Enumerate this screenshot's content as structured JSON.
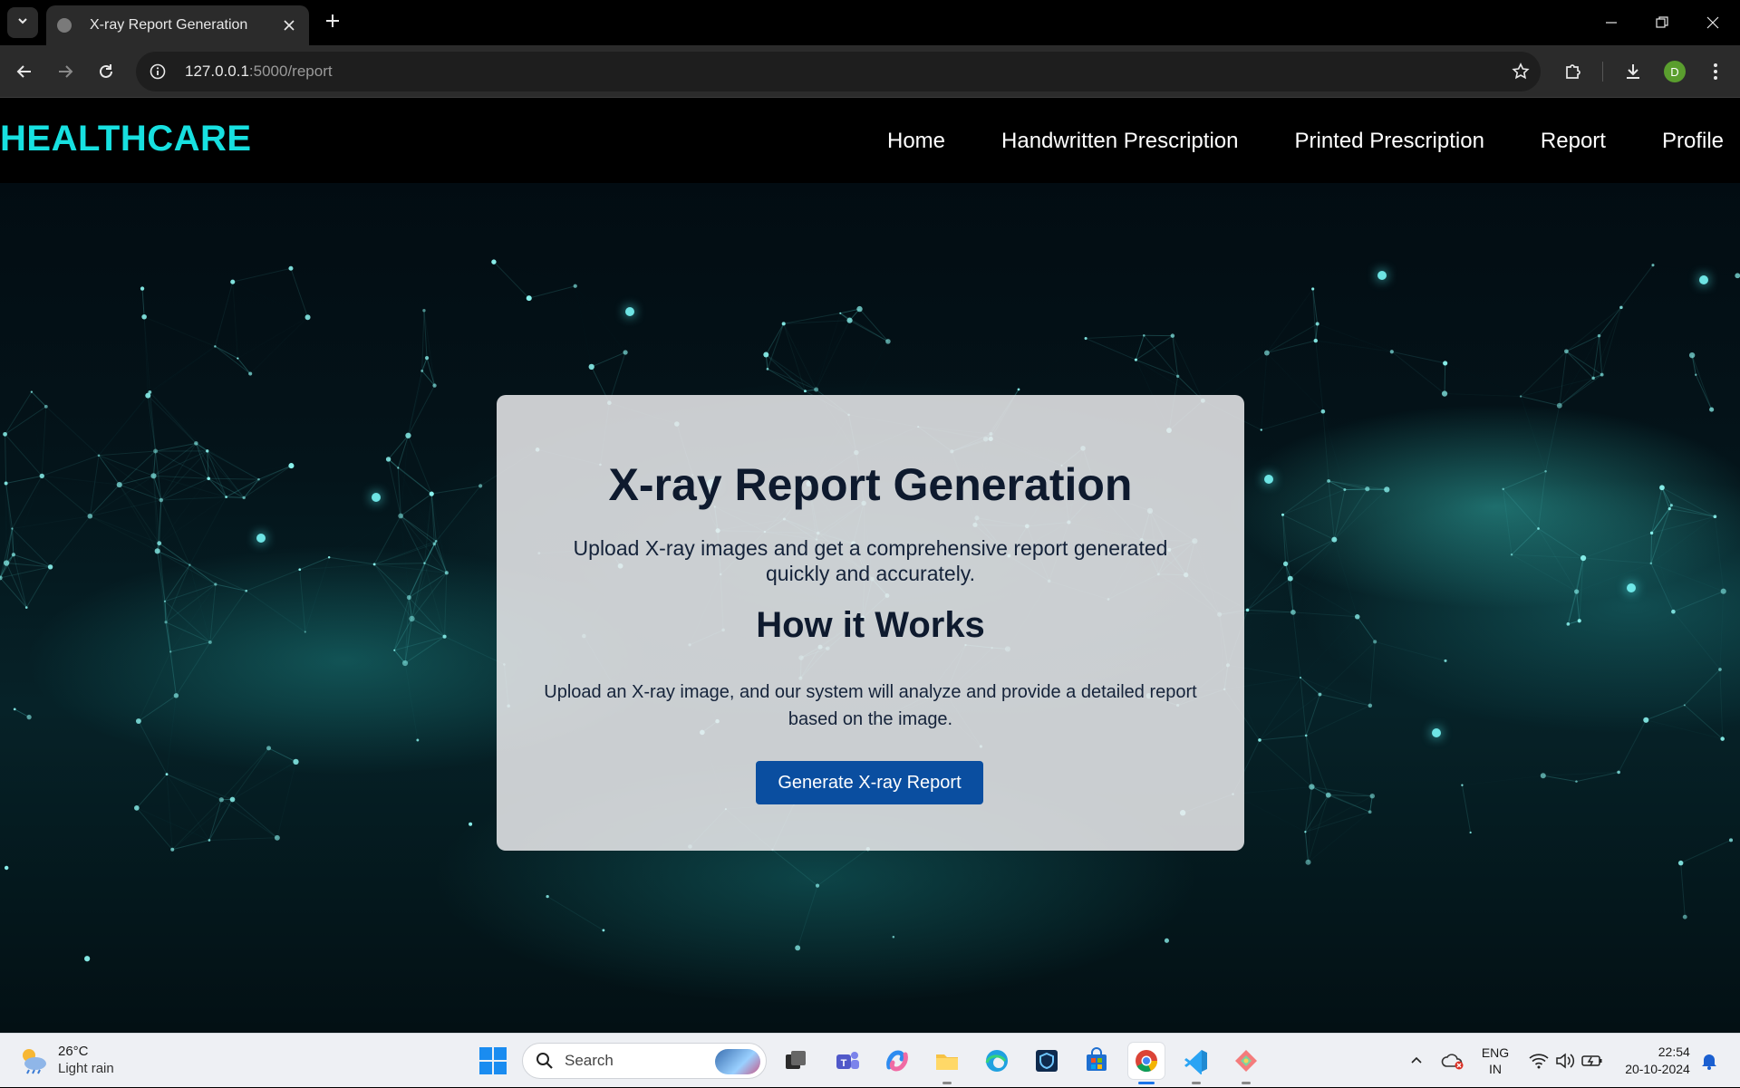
{
  "browser": {
    "tab_title": "X-ray Report Generation",
    "url_host": "127.0.0.1",
    "url_path": ":5000/report",
    "profile_initial": "D"
  },
  "site": {
    "logo": "HEALTHCARE",
    "nav": [
      "Home",
      "Handwritten Prescription",
      "Printed Prescription",
      "Report",
      "Profile"
    ]
  },
  "card": {
    "title": "X-ray Report Generation",
    "lead": "Upload X-ray images and get a comprehensive report generated quickly and accurately.",
    "how_title": "How it Works",
    "how_desc": "Upload an X-ray image, and our system will analyze and provide a detailed report based on the image.",
    "button": "Generate X-ray Report"
  },
  "taskbar": {
    "temperature": "26°C",
    "weather": "Light rain",
    "search_label": "Search",
    "lang_top": "ENG",
    "lang_bottom": "IN",
    "time": "22:54",
    "date": "20-10-2024"
  },
  "colors": {
    "logo": "#17e0e0",
    "button": "#0a4ea0",
    "heading": "#0e1a2e"
  }
}
